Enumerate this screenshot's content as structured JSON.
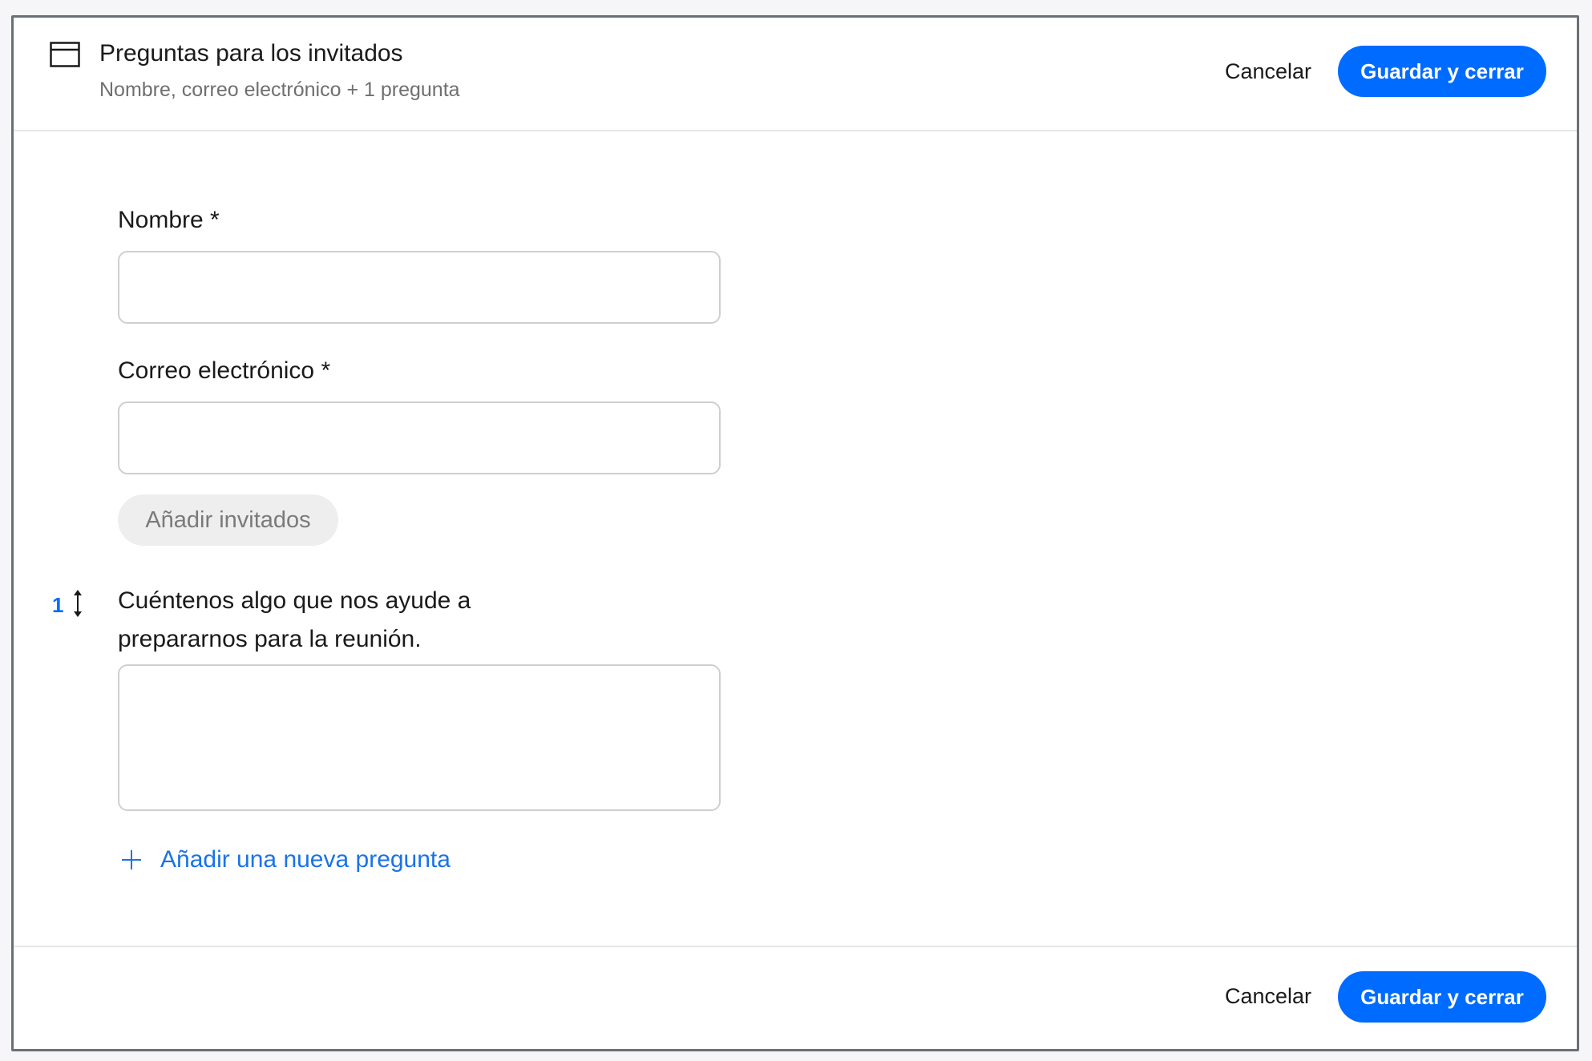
{
  "header": {
    "icon": "form-window-icon",
    "title": "Preguntas para los invitados",
    "subtitle": "Nombre, correo electrónico + 1 pregunta",
    "cancel_label": "Cancelar",
    "save_label": "Guardar y cerrar"
  },
  "form": {
    "name_label": "Nombre *",
    "name_value": "",
    "email_label": "Correo electrónico *",
    "email_value": "",
    "add_guests_label": "Añadir invitados",
    "questions": [
      {
        "number": "1",
        "label": "Cuéntenos algo que nos ayude a prepararnos para la reunión.",
        "value": ""
      }
    ],
    "add_question_label": "Añadir una nueva pregunta"
  },
  "footer": {
    "cancel_label": "Cancelar",
    "save_label": "Guardar y cerrar"
  },
  "colors": {
    "accent": "#006bff",
    "link": "#1a73e8",
    "border": "#cfcfcf"
  }
}
